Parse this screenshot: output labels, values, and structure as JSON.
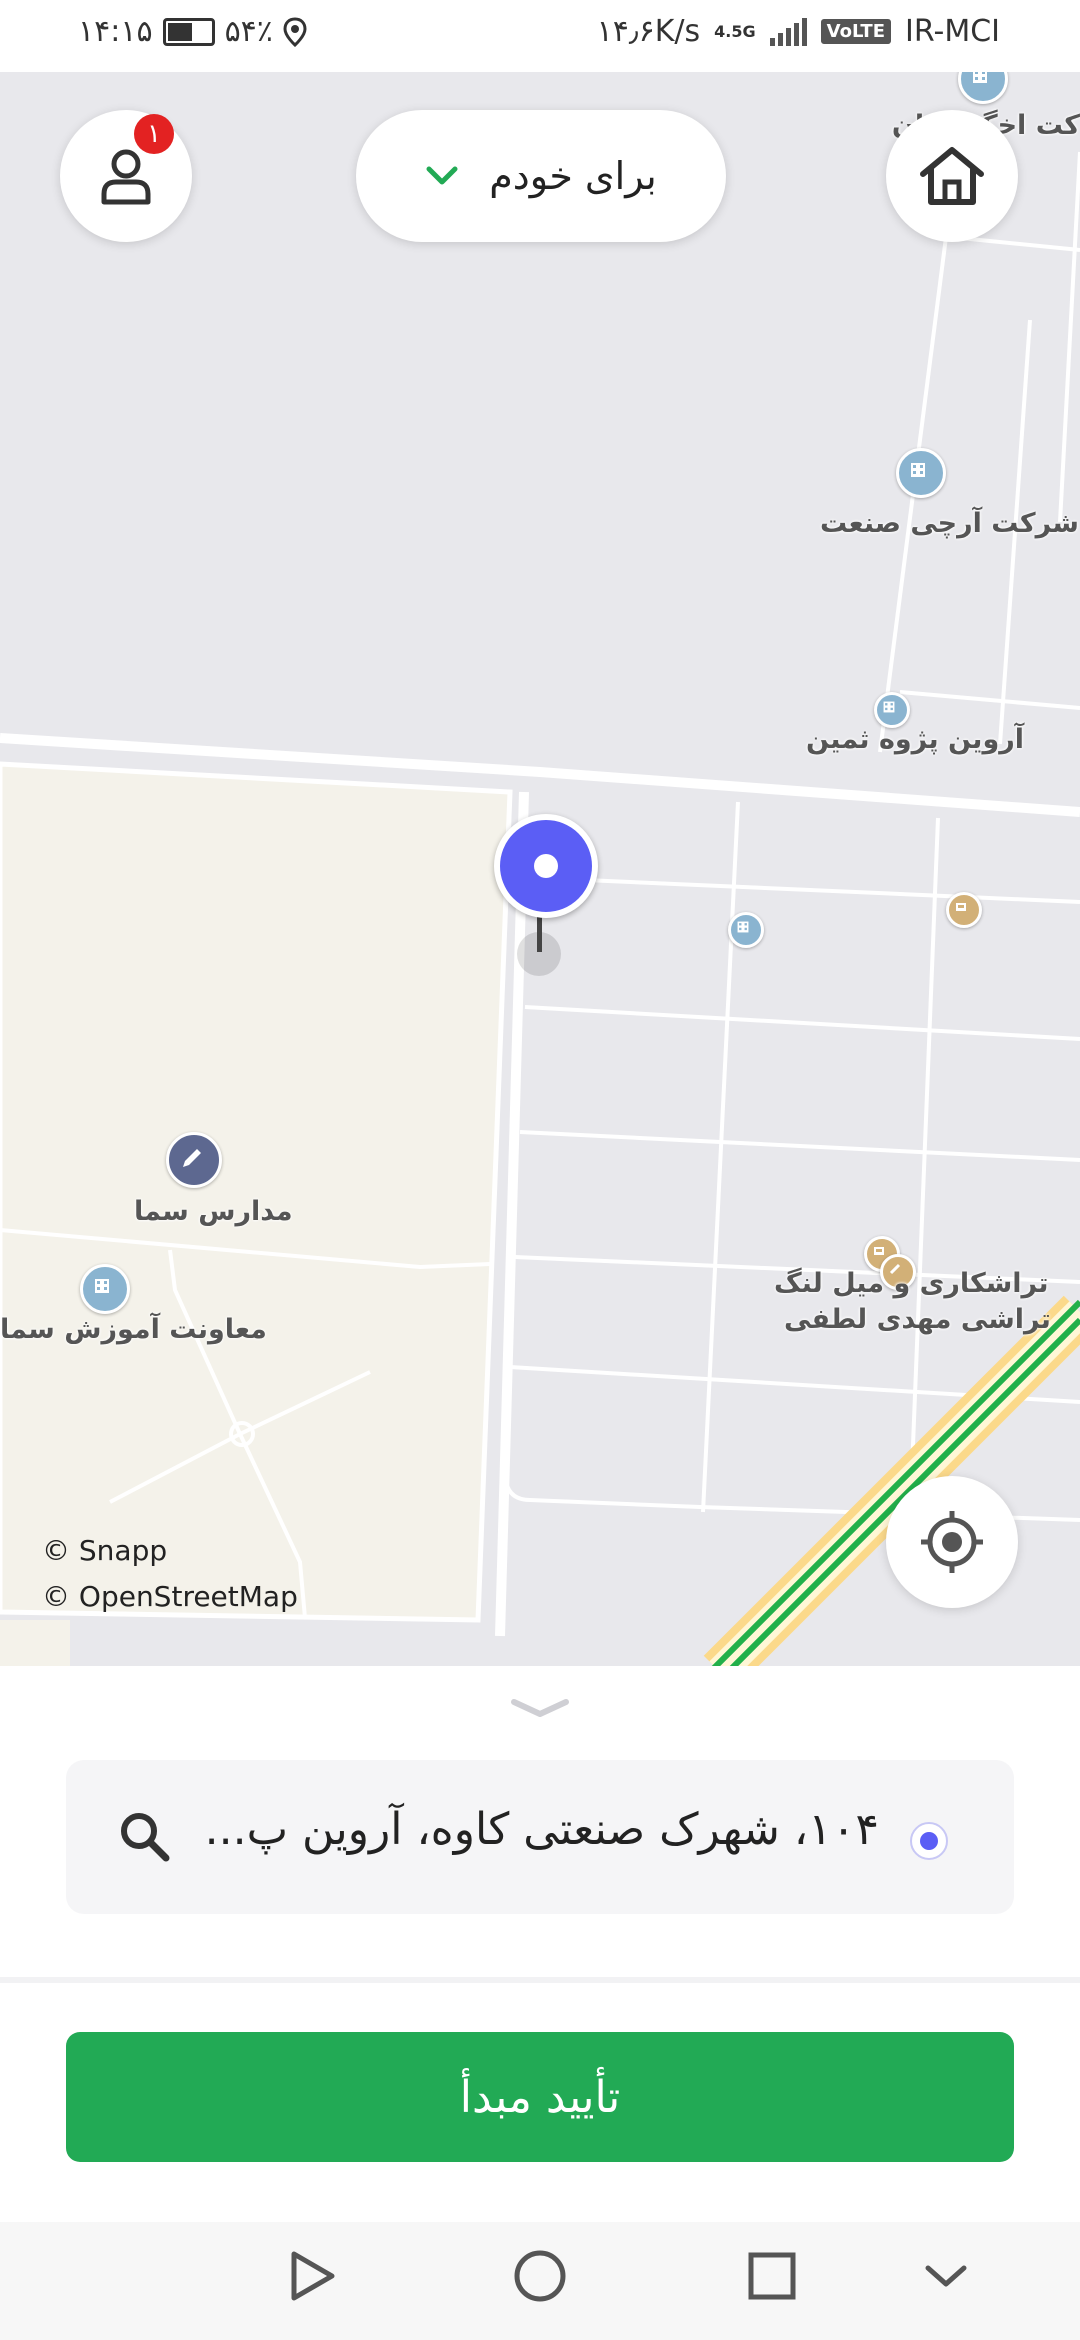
{
  "status_bar": {
    "time": "۱۴:۱۵",
    "battery": "۵۴٪",
    "speed": "۱۴٫۶K/s",
    "network": "4.5G",
    "volte": "VoLTE",
    "carrier": "IR-MCI"
  },
  "header": {
    "profile_badge": "۱",
    "for_me_label": "برای خودم"
  },
  "map": {
    "labels": {
      "isfahan_partial": "کت اخگ   فهان",
      "archi_sanat": "شرکت آرچی صنعت",
      "arvin_pajooh": "آروین پژوه ثمین",
      "madares_sama": "مدارس سما",
      "moavenat": "معاونت آموزش سما",
      "tarashkari_line1": "تراشکاری و میل لنگ",
      "tarashkari_line2": "تراشی مهدی لطفی"
    },
    "credits": {
      "snapp": "© Snapp",
      "osm": "© OpenStreetMap"
    }
  },
  "bottom": {
    "address": "۱۰۴، شهرک صنعتی کاوه، آروین پ...",
    "confirm_label": "تأیید مبدأ"
  },
  "colors": {
    "accent_green": "#22aa55",
    "pin_blue": "#5b5ef5",
    "badge_red": "#e32222"
  }
}
